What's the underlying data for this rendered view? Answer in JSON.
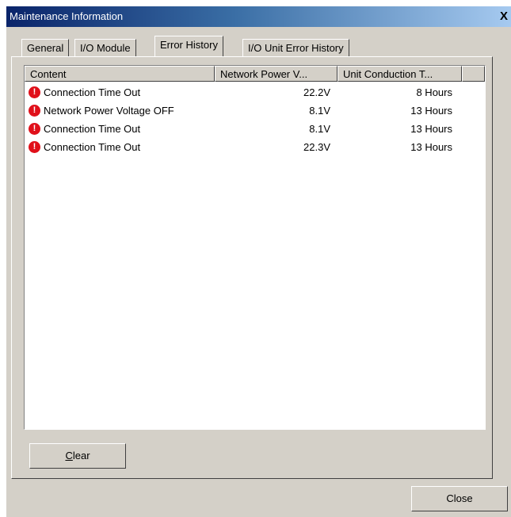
{
  "window": {
    "title": "Maintenance Information",
    "close_glyph": "X"
  },
  "tabs": [
    {
      "label": "General",
      "active": false
    },
    {
      "label": "I/O Module",
      "active": false
    },
    {
      "label": "Error History",
      "active": true
    },
    {
      "label": "I/O Unit Error History",
      "active": false
    }
  ],
  "list": {
    "columns": [
      "Content",
      "Network Power V...",
      "Unit Conduction T..."
    ],
    "rows": [
      {
        "icon": "error-icon",
        "content": "Connection Time Out",
        "voltage": "22.2V",
        "conduction": "8 Hours"
      },
      {
        "icon": "error-icon",
        "content": "Network Power Voltage OFF",
        "voltage": "8.1V",
        "conduction": "13 Hours"
      },
      {
        "icon": "error-icon",
        "content": "Connection Time Out",
        "voltage": "8.1V",
        "conduction": "13 Hours"
      },
      {
        "icon": "error-icon",
        "content": "Connection Time Out",
        "voltage": "22.3V",
        "conduction": "13 Hours"
      }
    ]
  },
  "buttons": {
    "clear_mnemonic": "C",
    "clear_rest": "lear",
    "close": "Close"
  },
  "colors": {
    "error_icon": "#e0101a",
    "titlebar_start": "#0a246a",
    "titlebar_end": "#a6caf0"
  }
}
